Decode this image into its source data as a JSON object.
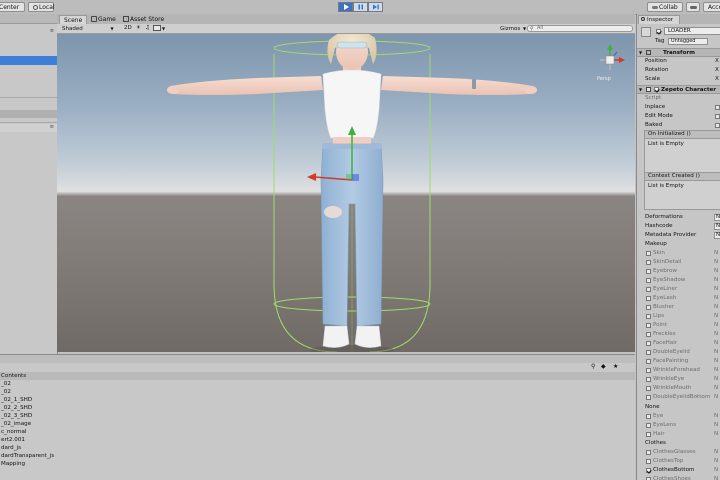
{
  "toolbar": {
    "center_label": "Center",
    "local_label": "Local",
    "collab_label": "Collab",
    "account_label": "Acco"
  },
  "scene": {
    "tabs": [
      "Scene",
      "Game",
      "Asset Store"
    ],
    "shading": "Shaded",
    "mode_2d": "2D",
    "gizmos": "Gizmos",
    "search_placeholder": "All",
    "persp_label": "Persp"
  },
  "project": {
    "header": "Contents",
    "items": [
      "_02",
      "_02",
      "_02_1_SHD",
      "_02_2_SHD",
      "_02_3_SHD",
      "_02_image",
      "c_normal",
      "ert2.001",
      "dard_js",
      "dardTransparent_js",
      "Mapping"
    ]
  },
  "inspector": {
    "tab": "Inspector",
    "object_name": "LOADER",
    "tag_label": "Tag",
    "tag_value": "Untagged",
    "transform": {
      "title": "Transform",
      "rows": [
        "Position",
        "Rotation",
        "Scale"
      ],
      "axis": "X"
    },
    "zepeto": {
      "title": "Zepeto Character",
      "script_label": "Script",
      "toggles": [
        "Inplace",
        "Edit Mode",
        "Baked"
      ],
      "on_initialized": "On Initialized ()",
      "context_created": "Context Created ()",
      "list_empty": "List is Empty",
      "deformations": "Deformations",
      "hashcode": "Hashcode",
      "metadata_provider": "Metadata Provider",
      "value_stub": "N",
      "makeup_label": "Makeup",
      "makeup": [
        "Skin",
        "SkinDetail",
        "Eyebrow",
        "EyeShadow",
        "EyeLiner",
        "EyeLash",
        "Blusher",
        "Lips",
        "Point",
        "Freckles",
        "FaceHair",
        "DoubleEyelid",
        "FacePainting",
        "WrinkleForehead",
        "WrinkleEye",
        "WrinkleMouth",
        "DoubleEyelidBottom"
      ],
      "none_label": "None",
      "none_items": [
        "Eye",
        "EyeLens",
        "Hair"
      ],
      "clothes_label": "Clothes",
      "clothes_items": [
        "ClothesGlasses",
        "ClothesTop",
        "ClothesBottom",
        "ClothesShoes"
      ],
      "clothes_checked": "ClothesBottom"
    }
  },
  "colors": {
    "accent_blue": "#3a72c4",
    "selection": "#3d7fd6",
    "collider_green": "#9fdc6a",
    "gizmo_red": "#d23a2a",
    "gizmo_green": "#3db33d",
    "gizmo_blue": "#3a66d8"
  },
  "icons": [
    "play-icon",
    "pause-icon",
    "step-icon",
    "light-icon",
    "audio-icon",
    "image-icon",
    "scene-gizmo-icon",
    "lock-icon",
    "menu-icon",
    "component-icon"
  ]
}
